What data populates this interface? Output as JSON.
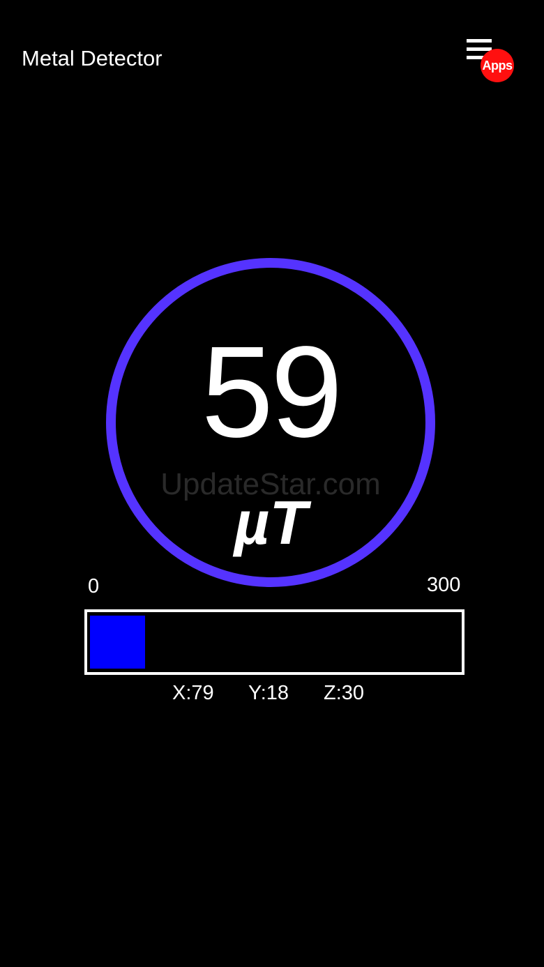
{
  "header": {
    "title": "Metal Detector",
    "menu_icon": "hamburger-menu-icon",
    "apps_badge_label": "Apps",
    "apps_badge_color": "#ff1010"
  },
  "gauge": {
    "value": "59",
    "unit": "µT",
    "ring_color": "#5533ff"
  },
  "watermark": {
    "text": "UpdateStar.com"
  },
  "meter": {
    "min_label": "0",
    "max_label": "300",
    "level_fraction": 0.1496,
    "fill_color": "#0000ff"
  },
  "axes": {
    "x_label": "X:79",
    "y_label": "Y:18",
    "z_label": "Z:30"
  }
}
